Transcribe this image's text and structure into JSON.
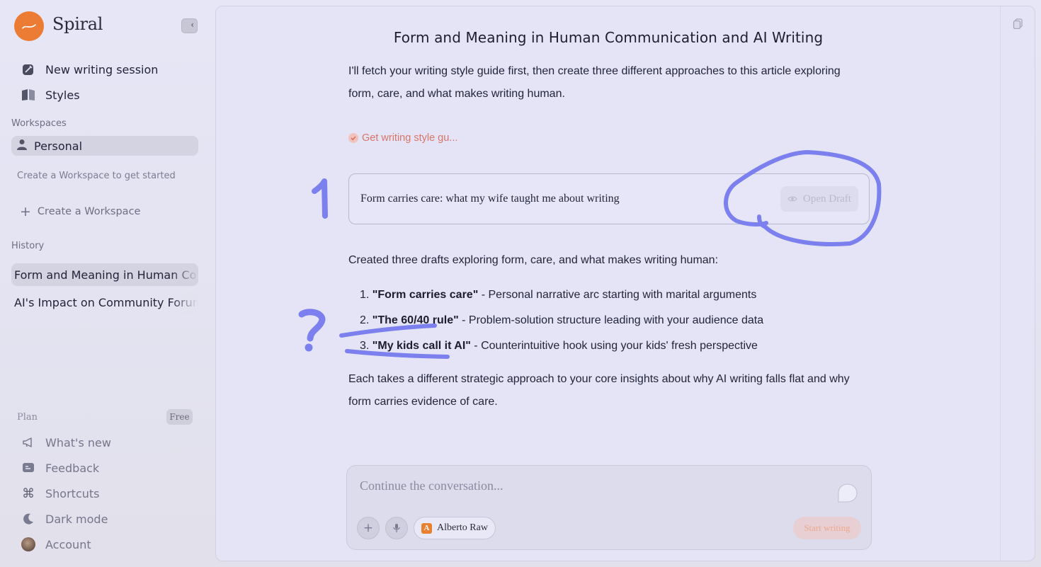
{
  "app": {
    "name": "Spiral",
    "brand_color": "#ec7c33"
  },
  "sidebar": {
    "primary": [
      {
        "label": "New writing session",
        "icon": "quill-edit-icon"
      },
      {
        "label": "Styles",
        "icon": "book-icon"
      }
    ],
    "workspaces_label": "Workspaces",
    "active_workspace": "Personal",
    "workspace_hint": "Create a Workspace to get started",
    "create_workspace": "Create a Workspace",
    "history_label": "History",
    "history": [
      "Form and Meaning in Human Co",
      "AI's Impact on Community Forum"
    ],
    "plan_label": "Plan",
    "plan_badge": "Free",
    "bottom": [
      {
        "label": "What's new",
        "icon": "megaphone-icon"
      },
      {
        "label": "Feedback",
        "icon": "feedback-icon"
      },
      {
        "label": "Shortcuts",
        "icon": "command-icon"
      },
      {
        "label": "Dark mode",
        "icon": "moon-icon"
      },
      {
        "label": "Account",
        "icon": "avatar"
      }
    ]
  },
  "main": {
    "title": "Form and Meaning in Human Communication and AI Writing",
    "intro": "I'll fetch your writing style guide first, then create three different approaches to this article exploring form, care, and what makes writing human.",
    "tool_status": "Get writing style gu...",
    "draft_card": {
      "title": "Form carries care: what my wife taught me about writing",
      "open_label": "Open Draft"
    },
    "summary": "Created three drafts exploring form, care, and what makes writing human:",
    "drafts": [
      {
        "num": "1.",
        "title": "\"Form carries care\"",
        "desc": " - Personal narrative arc starting with marital arguments"
      },
      {
        "num": "2.",
        "title": "\"The 60/40 rule\"",
        "desc": " - Problem-solution structure leading with your audience data"
      },
      {
        "num": "3.",
        "title": "\"My kids call it AI\"",
        "desc": " - Counterintuitive hook using your kids' fresh perspective"
      }
    ],
    "closing": "Each takes a different strategic approach to your core insights about why AI writing falls flat and why form carries evidence of care."
  },
  "composer": {
    "placeholder": "Continue the conversation...",
    "style_initial": "A",
    "style_name": "Alberto Raw",
    "start_label": "Start writing"
  },
  "annotations": {
    "marker_color": "#7b80ee",
    "number_mark": "1",
    "question_mark": "?"
  }
}
